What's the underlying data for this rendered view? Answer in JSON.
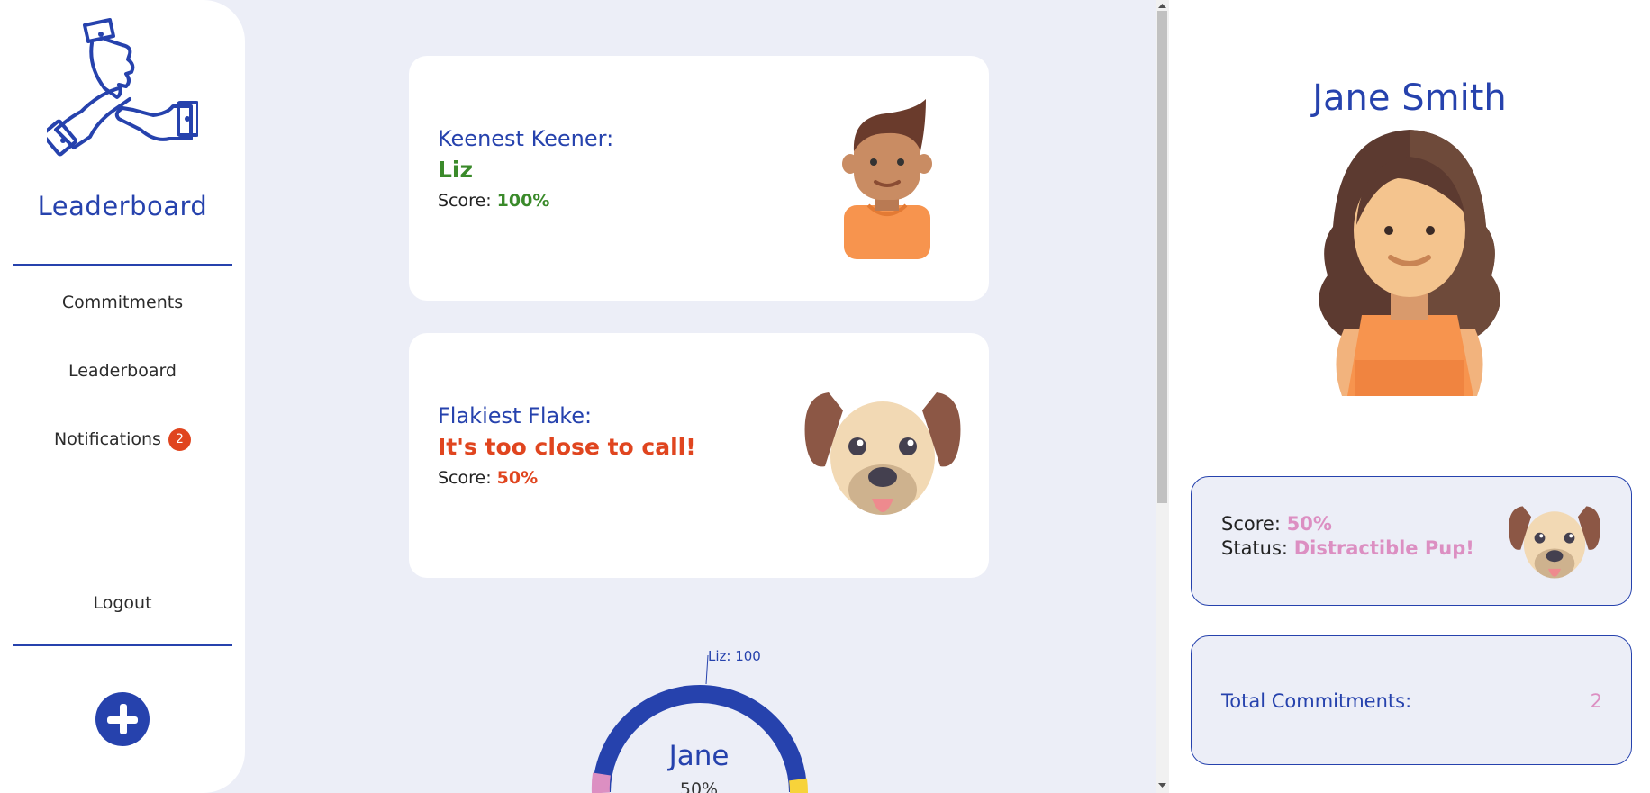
{
  "sidebar": {
    "brand_title": "Leaderboard",
    "nav": [
      {
        "label": "Commitments"
      },
      {
        "label": "Leaderboard"
      },
      {
        "label": "Notifications",
        "badge": "2"
      }
    ],
    "logout_label": "Logout"
  },
  "cards": {
    "keener": {
      "title": "Keenest Keener:",
      "name": "Liz",
      "score_label": "Score:",
      "score_value": "100%",
      "name_color": "#3a8a2a"
    },
    "flake": {
      "title": "Flakiest Flake:",
      "name": "It's too close to call!",
      "score_label": "Score:",
      "score_value": "50%",
      "name_color": "#e0451f"
    }
  },
  "donut": {
    "leader_label": "Liz: 100",
    "center_name": "Jane",
    "center_pct": "50%"
  },
  "profile": {
    "name": "Jane Smith",
    "score_label": "Score:",
    "score_value": "50%",
    "status_label": "Status:",
    "status_value": "Distractible Pup!",
    "total_label": "Total Commitments:",
    "total_value": "2"
  },
  "colors": {
    "accent": "#2642ad",
    "background": "#eceef7",
    "badge": "#e0451f",
    "pink": "#dc8fc2",
    "green": "#3a8a2a"
  },
  "icons": {
    "brand": "hands-stack-icon",
    "add": "plus-circle-icon"
  }
}
